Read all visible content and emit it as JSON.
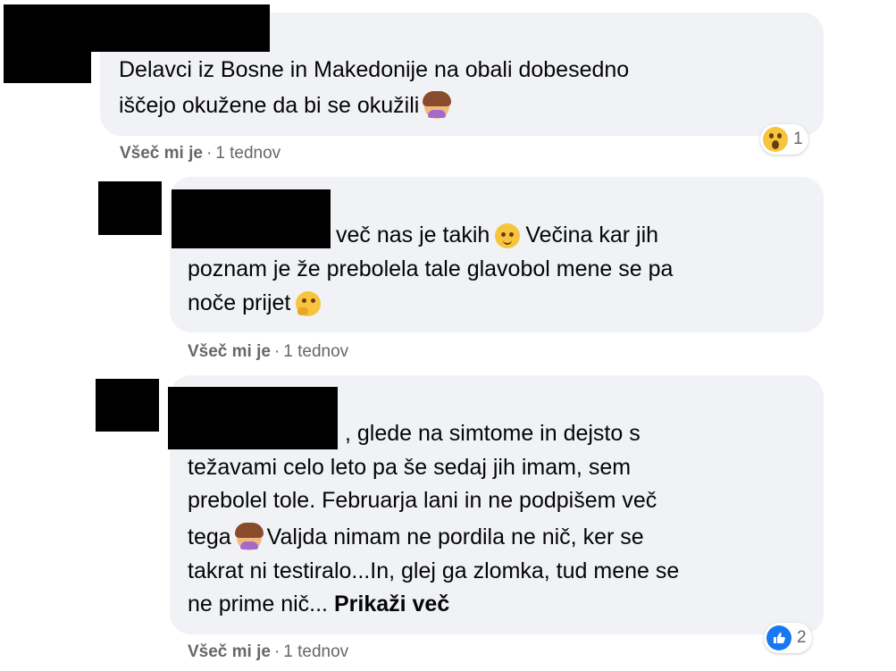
{
  "comments": [
    {
      "lines": [
        "Delavci iz Bosne in Makedonije na obali dobesedno",
        "iščejo okužene da bi se okužili"
      ],
      "trailing_emoji": "woman-facepalming-emoji",
      "meta": {
        "like_label": "Všeč mi je",
        "separator": "·",
        "time": "1 tednov"
      },
      "reaction": {
        "icon": "wow-reaction-icon",
        "count": "1"
      }
    },
    {
      "line1_suffix": "več nas je takih",
      "line1_after_emoji": "Večina kar jih",
      "line2": "poznam je že prebolela tale glavobol mene se pa",
      "line3": "noče prijet",
      "emojis": [
        "winking-face-emoji",
        "thinking-face-emoji"
      ],
      "meta": {
        "like_label": "Všeč mi je",
        "separator": "·",
        "time": "1 tednov"
      }
    },
    {
      "line1_suffix": ", glede na simtome in dejsto s",
      "line2": "težavami celo leto pa še sedaj jih imam, sem",
      "line3": "prebolel tole. Februarja lani in ne podpišem več",
      "line4_start": "tega",
      "line4_end": "Valjda nimam ne pordila ne nič, ker se",
      "line5": "takrat ni testiralo...In, glej ga zlomka, tud mene se",
      "line6": "ne prime nič...",
      "see_more": "Prikaži več",
      "emojis": [
        "woman-facepalming-emoji"
      ],
      "meta": {
        "like_label": "Všeč mi je",
        "separator": "·",
        "time": "1 tednov"
      },
      "reaction": {
        "icon": "like-reaction-icon",
        "count": "2"
      }
    }
  ]
}
